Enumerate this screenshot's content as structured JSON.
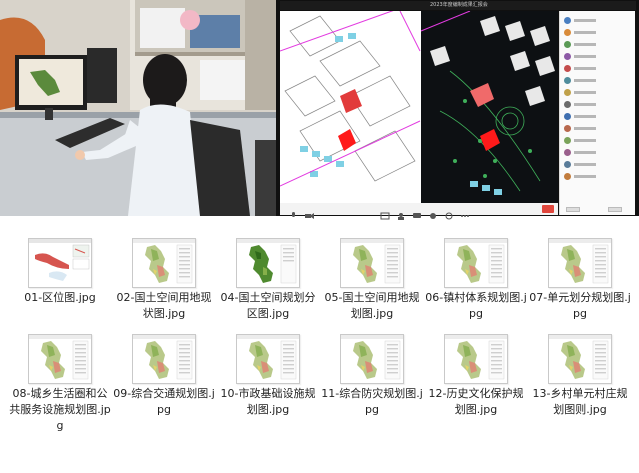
{
  "photo": {
    "description_icon": "woman-at-computer-photo",
    "colors": {
      "wall": "#d9d4cb",
      "desk": "#cfd3d6",
      "shirt": "#eef2f6",
      "hair": "#1c1a1a"
    }
  },
  "meeting": {
    "title": "2023年度编制成果汇报会",
    "toolbar_icons": [
      "mic-icon",
      "camera-icon",
      "share-icon",
      "members-icon",
      "chat-icon",
      "record-icon",
      "settings-icon",
      "more-icon"
    ],
    "end_button_color": "#e0463c",
    "participant_avatar_colors": [
      "#4a7fc1",
      "#d98b3a",
      "#5b9a56",
      "#8d5aa6",
      "#c44d4d",
      "#4f8c9c",
      "#c0a14a",
      "#6b6b6b",
      "#3f6fb0",
      "#b8694e",
      "#7aa35a",
      "#9a5f8c",
      "#5a7c99",
      "#c27c3d"
    ]
  },
  "files": [
    {
      "name": "01-区位图.jpg",
      "thumb": "location-map-icon"
    },
    {
      "name": "02-国土空间用地现状图.jpg",
      "thumb": "land-use-map-icon"
    },
    {
      "name": "04-国土空间规划分区图.jpg",
      "thumb": "zoning-map-icon"
    },
    {
      "name": "05-国土空间用地规划图.jpg",
      "thumb": "land-use-map-icon"
    },
    {
      "name": "06-镇村体系规划图.jpg",
      "thumb": "land-use-map-icon"
    },
    {
      "name": "07-单元划分规划图.jpg",
      "thumb": "land-use-map-icon"
    },
    {
      "name": "08-城乡生活圈和公共服务设施规划图.jpg",
      "thumb": "land-use-map-icon"
    },
    {
      "name": "09-综合交通规划图.jpg",
      "thumb": "land-use-map-icon"
    },
    {
      "name": "10-市政基础设施规划图.jpg",
      "thumb": "land-use-map-icon"
    },
    {
      "name": "11-综合防灾规划图.jpg",
      "thumb": "land-use-map-icon"
    },
    {
      "name": "12-历史文化保护规划图.jpg",
      "thumb": "land-use-map-icon"
    },
    {
      "name": "13-乡村单元村庄规划图则.jpg",
      "thumb": "land-use-map-icon"
    }
  ]
}
